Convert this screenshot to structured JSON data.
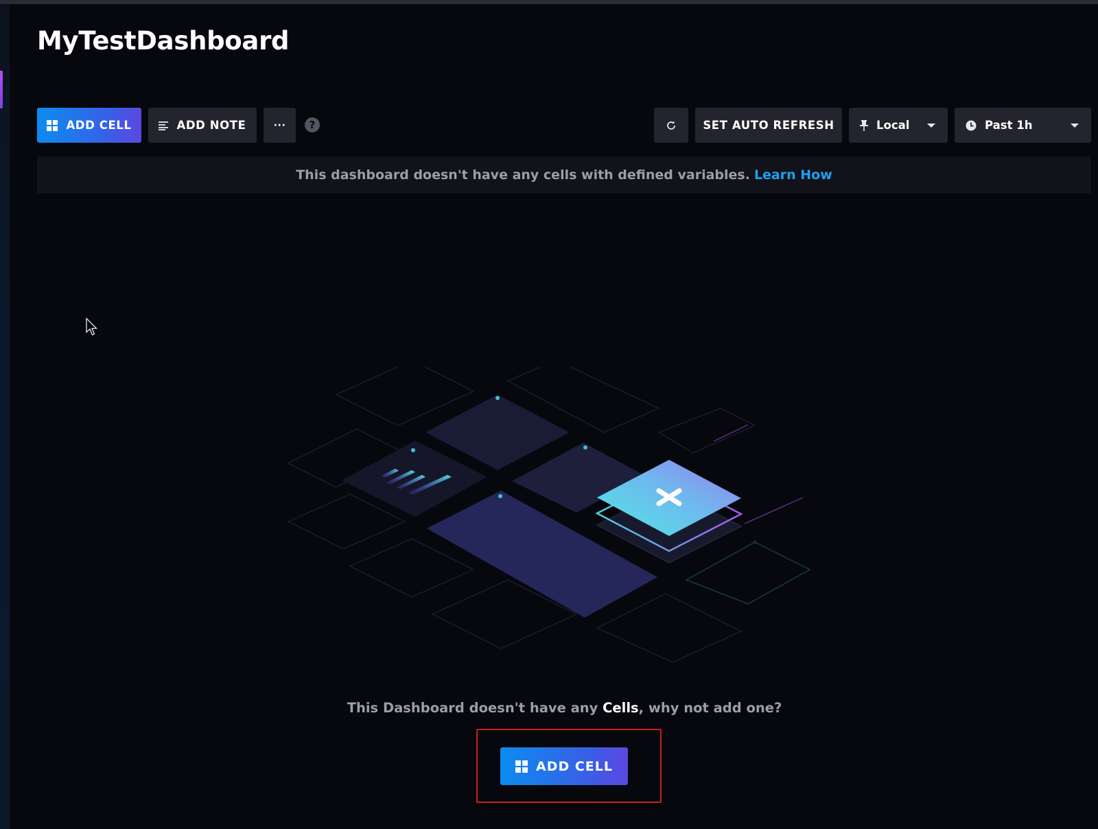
{
  "dashboard": {
    "title": "MyTestDashboard"
  },
  "toolbar": {
    "add_cell_label": "ADD CELL",
    "add_note_label": "ADD NOTE",
    "more_label": "···",
    "help_label": "?",
    "auto_refresh_label": "SET AUTO REFRESH",
    "timezone_value": "Local",
    "time_range_value": "Past 1h"
  },
  "banner": {
    "message": "This dashboard doesn't have any cells with defined variables.",
    "link_text": "Learn How"
  },
  "empty_state": {
    "text_before": "This Dashboard doesn't have any ",
    "text_bold": "Cells",
    "text_after": ", why not add one?",
    "add_cell_label": "ADD CELL"
  },
  "colors": {
    "background": "#07080d",
    "button": "#23242d",
    "primary_start": "#0b8cf0",
    "primary_end": "#5b48e0",
    "link": "#1da1f2",
    "highlight_box": "#d11b1b"
  }
}
